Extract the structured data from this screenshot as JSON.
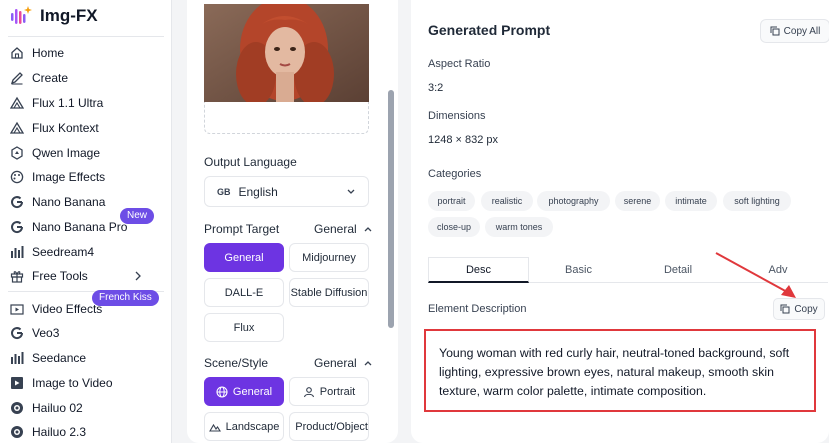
{
  "app": {
    "name": "Img-FX"
  },
  "sidebar": {
    "items": [
      {
        "label": "Home",
        "icon": "home-icon"
      },
      {
        "label": "Create",
        "icon": "pen-icon"
      },
      {
        "label": "Flux 1.1 Ultra",
        "icon": "flux-icon"
      },
      {
        "label": "Flux Kontext",
        "icon": "flux-icon"
      },
      {
        "label": "Qwen Image",
        "icon": "qwen-icon"
      },
      {
        "label": "Image Effects",
        "icon": "palette-icon"
      },
      {
        "label": "Nano Banana",
        "icon": "google-icon"
      },
      {
        "label": "Nano Banana Pro",
        "icon": "google-icon",
        "badge": "New"
      },
      {
        "label": "Seedream4",
        "icon": "bars-icon"
      },
      {
        "label": "Free Tools",
        "icon": "gift-icon"
      },
      {
        "label": "Video Effects",
        "icon": "video-icon",
        "badge": "French Kiss"
      },
      {
        "label": "Veo3",
        "icon": "google-icon"
      },
      {
        "label": "Seedance",
        "icon": "bars-icon"
      },
      {
        "label": "Image to Video",
        "icon": "image-video-icon"
      },
      {
        "label": "Hailuo 02",
        "icon": "hailuo-icon"
      },
      {
        "label": "Hailuo 2.3",
        "icon": "hailuo-icon"
      }
    ]
  },
  "settings": {
    "output_language_label": "Output Language",
    "language_code": "GB",
    "language_value": "English",
    "prompt_target_label": "Prompt Target",
    "prompt_target_mode": "General",
    "prompt_targets": [
      "General",
      "Midjourney",
      "DALL-E",
      "Stable Diffusion",
      "Flux"
    ],
    "scene_style_label": "Scene/Style",
    "scene_style_mode": "General",
    "scene_styles": [
      "General",
      "Portrait",
      "Landscape",
      "Product/Object"
    ]
  },
  "result": {
    "title": "Generated Prompt",
    "copy_all_label": "Copy All",
    "aspect_ratio_label": "Aspect Ratio",
    "aspect_ratio_value": "3:2",
    "dimensions_label": "Dimensions",
    "dimensions_value": "1248 × 832 px",
    "categories_label": "Categories",
    "categories": [
      "portrait",
      "realistic",
      "photography",
      "serene",
      "intimate",
      "soft lighting",
      "close-up",
      "warm tones"
    ],
    "tabs": [
      "Desc",
      "Basic",
      "Detail",
      "Adv"
    ],
    "active_tab": "Desc",
    "element_description_label": "Element Description",
    "copy_label": "Copy",
    "description": "Young woman with red curly hair, neutral-toned background, soft lighting, expressive brown eyes, natural makeup, smooth skin texture, warm color palette, intimate composition."
  },
  "colors": {
    "accent": "#6d34e2",
    "badge": "#6d4de6",
    "highlight": "#e0383c"
  }
}
